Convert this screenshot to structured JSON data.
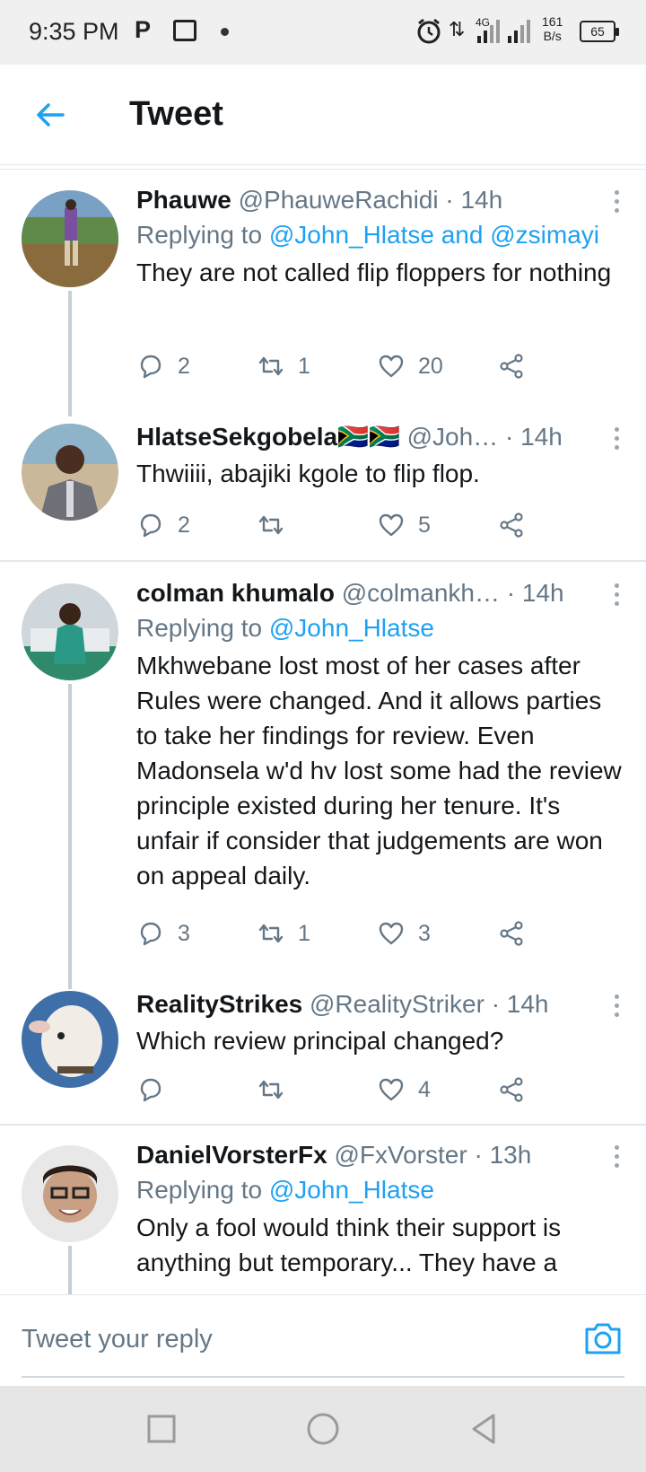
{
  "status_bar": {
    "time": "9:35 PM",
    "network": "4G",
    "speed_value": "161",
    "speed_unit": "B/s",
    "battery": "65"
  },
  "header": {
    "title": "Tweet"
  },
  "tweets": [
    {
      "name": "Phauwe",
      "handle": "@PhauweRachidi",
      "time": "· 14h",
      "replying_prefix": "Replying to ",
      "mentions": "@John_Hlatse and @zsimayi",
      "text": "They are not called flip floppers for nothing",
      "replies": "2",
      "retweets": "1",
      "likes": "20"
    },
    {
      "name": "HlatseSekgobela🇿🇦🇿🇦",
      "handle": "@Joh…",
      "time": "· 14h",
      "text": "Thwiiii, abajiki kgole to flip flop.",
      "replies": "2",
      "retweets": "",
      "likes": "5"
    },
    {
      "name": "colman khumalo",
      "handle": "@colmankh…",
      "time": "· 14h",
      "replying_prefix": "Replying to ",
      "mentions": "@John_Hlatse",
      "text": "Mkhwebane lost most of her cases after Rules were changed. And it allows parties to take her findings for review. Even Madonsela w'd hv lost some had the review principle existed during her tenure. It's unfair if consider that judgements are won on appeal daily.",
      "replies": "3",
      "retweets": "1",
      "likes": "3"
    },
    {
      "name": "RealityStrikes",
      "handle": "@RealityStriker",
      "time": "· 14h",
      "text": "Which review principal changed?",
      "replies": "",
      "retweets": "",
      "likes": "4"
    },
    {
      "name": "DanielVorsterFx",
      "handle": "@FxVorster",
      "time": "· 13h",
      "replying_prefix": "Replying to ",
      "mentions": "@John_Hlatse",
      "text": "Only a fool would think their support is anything but temporary... They have a"
    }
  ],
  "reply_bar": {
    "placeholder": "Tweet your reply"
  },
  "colors": {
    "accent": "#1da1f2",
    "text": "#14171a",
    "secondary": "#657786"
  },
  "icons": {
    "back": "arrow-left-icon",
    "more": "more-vertical-icon",
    "reply": "reply-bubble-icon",
    "retweet": "retweet-icon",
    "like": "heart-icon",
    "share": "share-icon",
    "camera": "camera-icon",
    "nav_recents": "square-icon",
    "nav_home": "circle-icon",
    "nav_back": "triangle-back-icon"
  }
}
